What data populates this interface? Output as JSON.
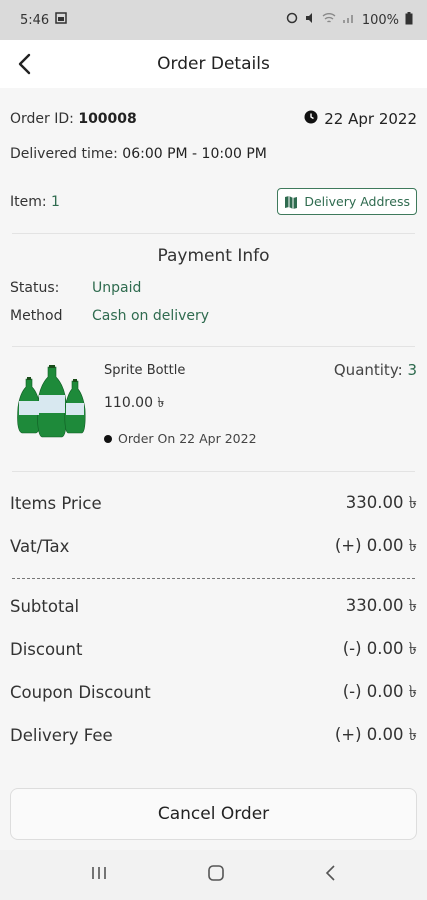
{
  "status_bar": {
    "time": "5:46",
    "battery": "100%"
  },
  "header": {
    "title": "Order Details"
  },
  "order": {
    "id_label": "Order ID:",
    "id_value": "100008",
    "date": "22 Apr 2022",
    "delivered_label": "Delivered time:",
    "delivered_value": "06:00 PM - 10:00 PM",
    "item_label": "Item:",
    "item_count": "1",
    "delivery_address_button": "Delivery Address"
  },
  "payment": {
    "heading": "Payment Info",
    "status_label": "Status:",
    "status_value": "Unpaid",
    "method_label": "Method",
    "method_value": "Cash on delivery"
  },
  "product": {
    "name": "Sprite Bottle",
    "price": "110.00 ৳",
    "quantity_label": "Quantity:",
    "quantity_value": "3",
    "order_on": "Order On 22 Apr 2022"
  },
  "summary": {
    "items_price_label": "Items Price",
    "items_price_value": "330.00 ৳",
    "vat_label": "Vat/Tax",
    "vat_value": "(+) 0.00 ৳",
    "subtotal_label": "Subtotal",
    "subtotal_value": "330.00 ৳",
    "discount_label": "Discount",
    "discount_value": "(-) 0.00 ৳",
    "coupon_label": "Coupon Discount",
    "coupon_value": "(-) 0.00 ৳",
    "delivery_label": "Delivery Fee",
    "delivery_value": "(+) 0.00 ৳"
  },
  "actions": {
    "cancel_label": "Cancel Order"
  },
  "colors": {
    "accent": "#2f6b4f"
  }
}
